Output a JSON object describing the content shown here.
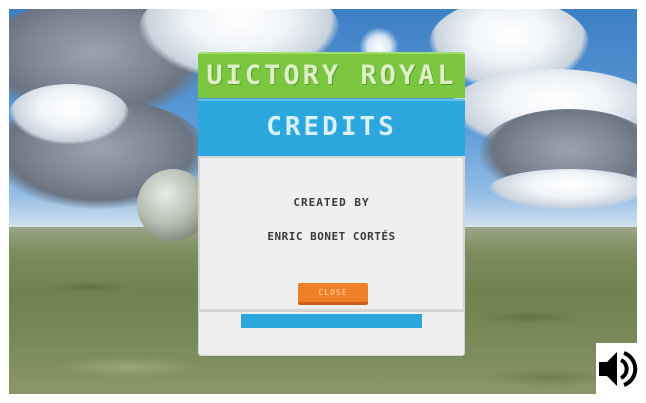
{
  "game": {
    "title": "UICTORY ROYAL",
    "dialog_title": "CREDITS",
    "credit_line1": "CREATED BY",
    "credit_line2": "ENRIC BONET CORTÉS",
    "close_label": "CLOSE"
  },
  "icons": {
    "sound": "speaker-volume-icon"
  },
  "colors": {
    "title_bar": "#7bc63f",
    "credits_bar": "#2ba7de",
    "close_button": "#f08028",
    "panel": "#efefef"
  }
}
